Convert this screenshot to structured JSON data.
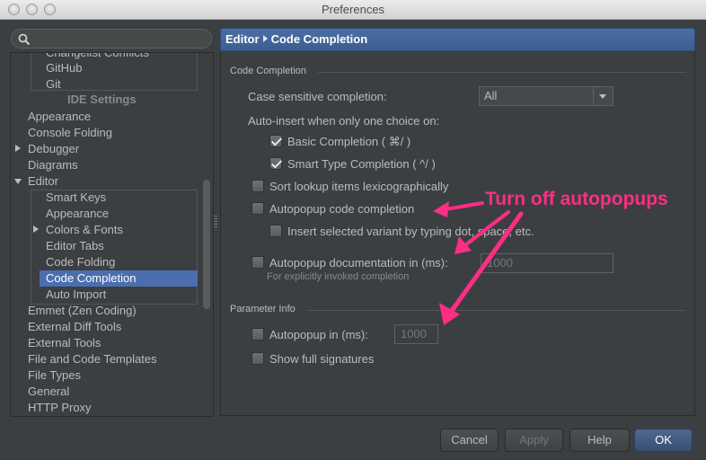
{
  "window": {
    "title": "Preferences"
  },
  "search": {
    "placeholder": ""
  },
  "tree": {
    "partial_top": "Changelist Conflicts",
    "vcs_items": [
      "GitHub",
      "Git"
    ],
    "section_label": "IDE Settings",
    "items": [
      {
        "label": "Appearance"
      },
      {
        "label": "Console Folding"
      },
      {
        "label": "Debugger",
        "expander": "collapsed"
      },
      {
        "label": "Diagrams"
      },
      {
        "label": "Editor",
        "expander": "expanded"
      }
    ],
    "editor_children": [
      {
        "label": "Smart Keys"
      },
      {
        "label": "Appearance"
      },
      {
        "label": "Colors & Fonts",
        "expander": "collapsed"
      },
      {
        "label": "Editor Tabs"
      },
      {
        "label": "Code Folding"
      },
      {
        "label": "Code Completion",
        "selected": true
      },
      {
        "label": "Auto Import"
      }
    ],
    "after_items": [
      {
        "label": "Emmet (Zen Coding)"
      },
      {
        "label": "External Diff Tools"
      },
      {
        "label": "External Tools"
      },
      {
        "label": "File and Code Templates"
      },
      {
        "label": "File Types"
      },
      {
        "label": "General"
      },
      {
        "label": "HTTP Proxy"
      }
    ]
  },
  "header": {
    "crumb_parent": "Editor",
    "crumb_current": "Code Completion"
  },
  "code_completion": {
    "group_title": "Code Completion",
    "case_sensitive_label": "Case sensitive completion:",
    "case_sensitive_value": "All",
    "auto_insert_label": "Auto-insert when only one choice on:",
    "basic_completion": {
      "label": "Basic Completion ( ⌘/ )",
      "checked": true
    },
    "smart_type_completion": {
      "label": "Smart Type Completion ( ^/ )",
      "checked": true
    },
    "sort_lookup": {
      "label": "Sort lookup items lexicographically",
      "checked": false
    },
    "autopopup_code": {
      "label": "Autopopup code completion",
      "checked": false
    },
    "insert_selected": {
      "label": "Insert selected variant by typing dot, space, etc.",
      "checked": false
    },
    "autopopup_doc": {
      "label": "Autopopup documentation in (ms):",
      "checked": false,
      "value": "1000"
    },
    "autopopup_doc_hint": "For explicitly invoked completion"
  },
  "parameter_info": {
    "group_title": "Parameter Info",
    "autopopup": {
      "label": "Autopopup in (ms):",
      "checked": false,
      "value": "1000"
    },
    "full_signatures": {
      "label": "Show full signatures",
      "checked": false
    }
  },
  "buttons": {
    "cancel": "Cancel",
    "apply": "Apply",
    "help": "Help",
    "ok": "OK"
  },
  "annotation": {
    "text": "Turn off autopopups",
    "color": "#ff2d86"
  }
}
